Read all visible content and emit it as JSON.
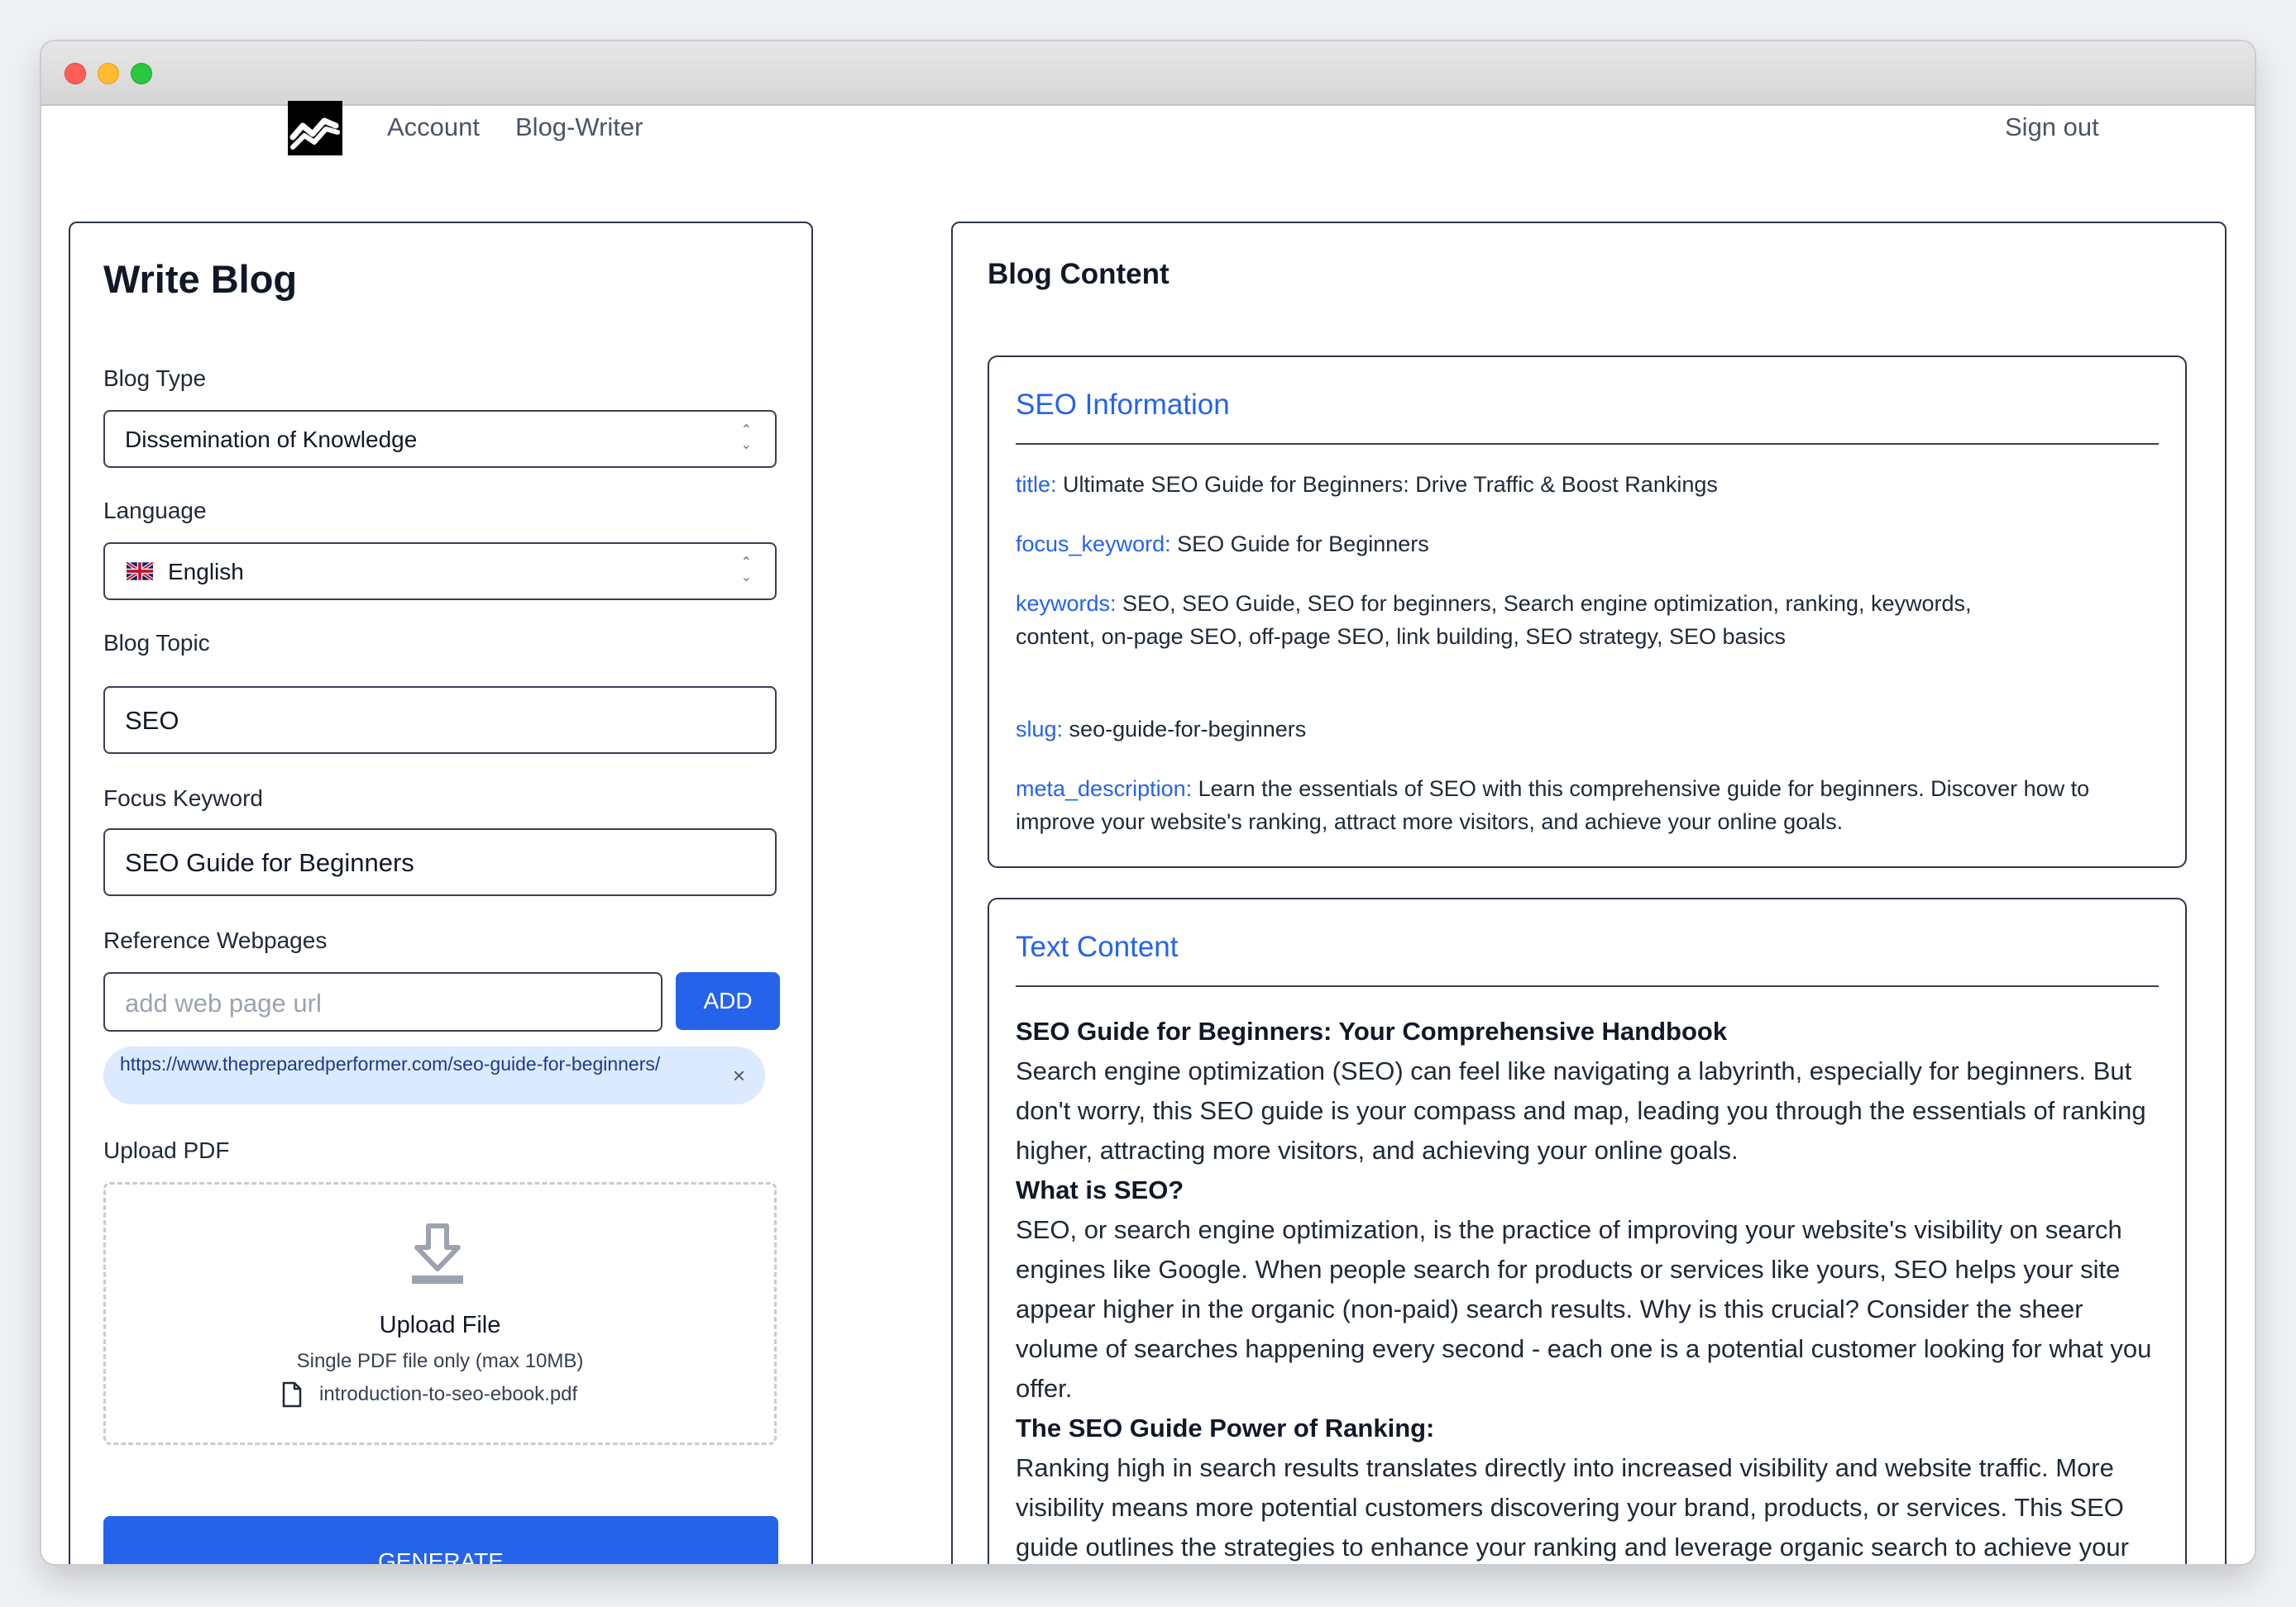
{
  "nav": {
    "account": "Account",
    "blog_writer": "Blog-Writer",
    "sign_out": "Sign out"
  },
  "write_blog": {
    "title": "Write Blog",
    "blog_type": {
      "label": "Blog Type",
      "value": "Dissemination of Knowledge"
    },
    "language": {
      "label": "Language",
      "value": "English",
      "flag": "uk-flag"
    },
    "blog_topic": {
      "label": "Blog Topic",
      "value": "SEO"
    },
    "focus_keyword": {
      "label": "Focus Keyword",
      "value": "SEO Guide for Beginners"
    },
    "reference": {
      "label": "Reference Webpages",
      "placeholder": "add web page url",
      "add_label": "ADD",
      "url": "https://www.thepreparedperformer.com/seo-guide-for-beginners/",
      "remove_icon": "×"
    },
    "upload": {
      "label": "Upload PDF",
      "title": "Upload File",
      "hint": "Single PDF file only (max 10MB)",
      "file_name": "introduction-to-seo-ebook.pdf"
    },
    "generate_label": "GENERATE"
  },
  "blog_content": {
    "title": "Blog Content",
    "seo": {
      "heading": "SEO Information",
      "rows": [
        {
          "key": "title:",
          "value": " Ultimate SEO Guide for Beginners: Drive Traffic & Boost Rankings"
        },
        {
          "key": "focus_keyword:",
          "value": " SEO Guide for Beginners"
        },
        {
          "key": "keywords:",
          "value": " SEO,  SEO Guide,  SEO for beginners,  Search engine optimization,  ranking,  keywords,  content,  on-page SEO,  off-page SEO,  link building,  SEO strategy,  SEO basics"
        },
        {
          "key": "slug:",
          "value": " seo-guide-for-beginners"
        },
        {
          "key": "meta_description:",
          "value": " Learn the essentials of SEO with this comprehensive guide for beginners. Discover how to improve your website's ranking, attract more visitors, and achieve your online goals."
        }
      ]
    },
    "text": {
      "heading": "Text Content",
      "h1": "SEO Guide for Beginners: Your Comprehensive Handbook",
      "p1": "Search engine optimization (SEO) can feel like navigating a labyrinth, especially for beginners. But don't worry, this SEO guide is your compass and map, leading you through the essentials of ranking higher, attracting more visitors, and achieving your online goals.",
      "h2": "What is SEO?",
      "p2": "SEO, or search engine optimization, is the practice of improving your website's visibility on search engines like Google. When people search for products or services like yours, SEO helps your site appear higher in the organic (non-paid) search results. Why is this crucial? Consider the sheer volume of searches happening every second - each one is a potential customer looking for what you offer.",
      "h3": "The SEO Guide Power of Ranking:",
      "p3": "Ranking high in search results translates directly into increased visibility and website traffic. More visibility means more potential customers discovering your brand, products, or services. This SEO guide outlines the strategies to enhance your ranking and leverage organic search to achieve your online objectives. Organic search listings, unlike paid ads, are where users"
    }
  }
}
